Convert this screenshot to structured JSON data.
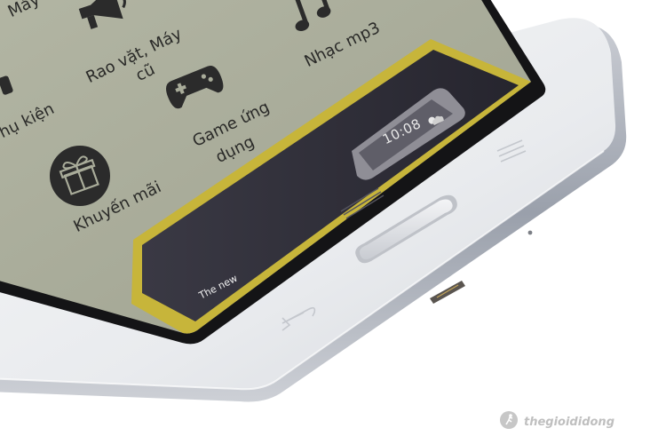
{
  "scene": {
    "description_colors": {
      "screen_bg": "#a9ac9a",
      "body_white": "#eef0f2",
      "bezel_black": "#141416",
      "banner_dark": "#2e2d38",
      "banner_border": "#c7b53a",
      "icon_dark": "#2b2b2b"
    }
  },
  "home_screen": {
    "items": [
      {
        "label_1": "Máy",
        "label_2": "",
        "icon": "partial-icon"
      },
      {
        "label_1": "Rao vặt, Máy",
        "label_2": "cũ",
        "icon": "megaphone-icon"
      },
      {
        "label_1": "Nhạc mp3",
        "label_2": "",
        "icon": "music-note-icon"
      },
      {
        "label_1": "hụ kiện",
        "label_2": "",
        "icon": "headphones-icon"
      },
      {
        "label_1": "Game ứng",
        "label_2": "dụng",
        "icon": "gamepad-icon"
      },
      {
        "label_1": "Khuyến mãi",
        "label_2": "",
        "icon": "gift-icon"
      }
    ]
  },
  "banner": {
    "clock": "10:08",
    "caption": "The new"
  },
  "watermark": {
    "text": "thegioididong",
    "icon": "runner-icon"
  }
}
